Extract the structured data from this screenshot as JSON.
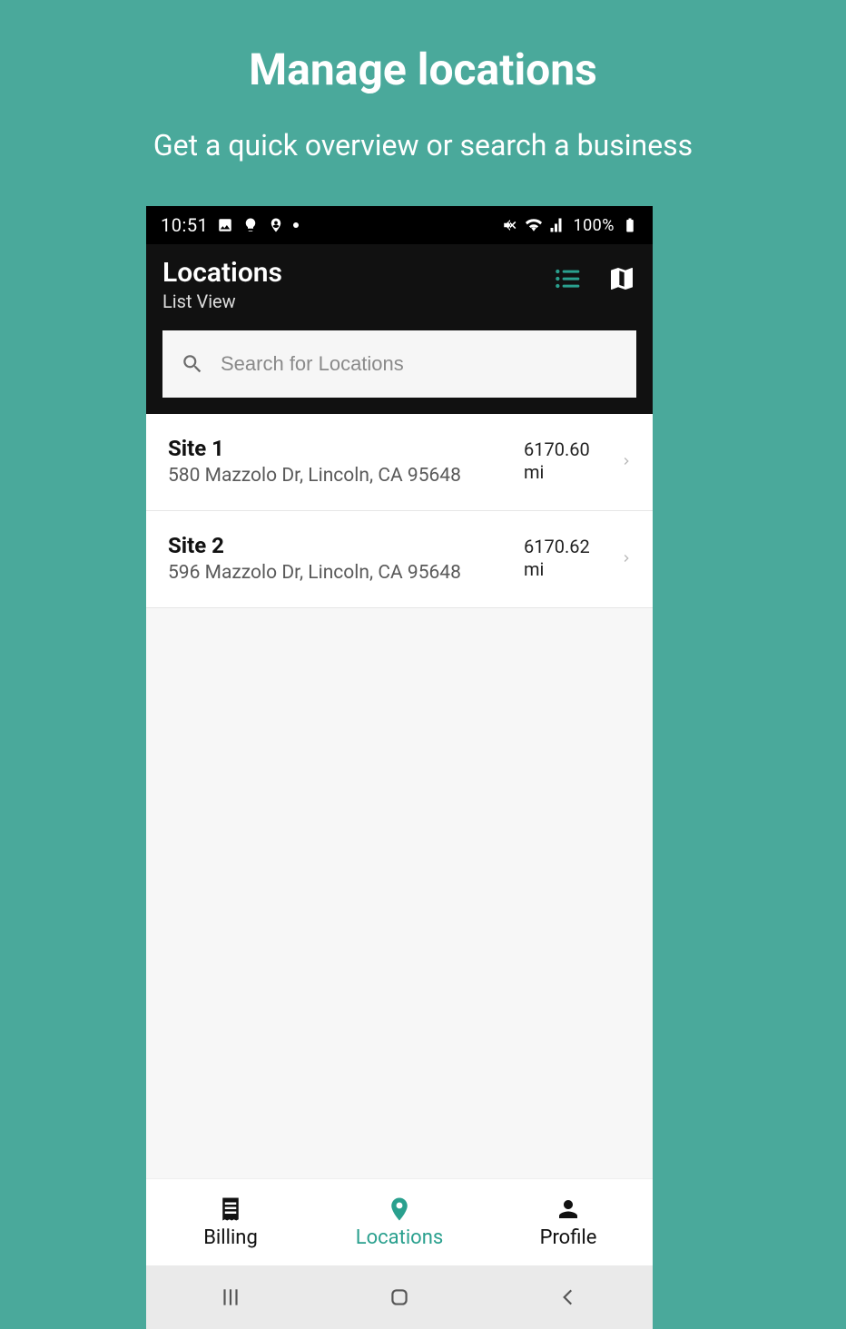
{
  "promo": {
    "title": "Manage locations",
    "subtitle": "Get a quick overview or search a business"
  },
  "status": {
    "time": "10:51",
    "battery": "100%"
  },
  "appbar": {
    "title": "Locations",
    "subtitle": "List View"
  },
  "search": {
    "placeholder": "Search for Locations"
  },
  "locations": [
    {
      "name": "Site 1",
      "address": "580 Mazzolo Dr, Lincoln, CA 95648",
      "distance": "6170.60",
      "unit": "mi"
    },
    {
      "name": "Site 2",
      "address": "596 Mazzolo Dr, Lincoln, CA 95648",
      "distance": "6170.62",
      "unit": "mi"
    }
  ],
  "tabs": {
    "billing": "Billing",
    "locations": "Locations",
    "profile": "Profile"
  }
}
